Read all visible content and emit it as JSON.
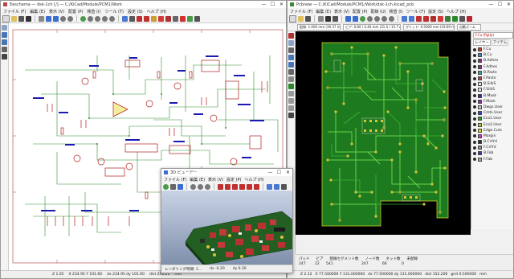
{
  "schematic": {
    "title": "Eeschema — dsk-1ch [/] — C:/KiCad/Module/PCM1/Work",
    "menu": [
      "ファイル (F)",
      "編集 (E)",
      "表示 (V)",
      "配置 (P)",
      "検査 (I)",
      "ツール (T)",
      "設定 (S)",
      "ヘルプ (H)"
    ],
    "status": {
      "zoom": "Z 1.05",
      "xy": "X 234.95  Y 101.60",
      "dxy": "dx 234.95  dy 101.60",
      "dist": "dist 256.21",
      "units": "mm"
    }
  },
  "pcbnew": {
    "title": "Pcbnew — C:/KiCad/Module/PCM1/Work/dsk-1ch.kicad_pcb",
    "menu": [
      "ファイル (F)",
      "編集 (E)",
      "表示 (V)",
      "配置 (P)",
      "配線 (U)",
      "検査 (I)",
      "ツール (T)",
      "設定 (S)",
      "ヘルプ (H)"
    ],
    "combos": [
      "配線: 1.000 mm (39.37 mils)",
      "ビア: 0.80 / 0.40 mm (31.5 / 15.7 mils)",
      "グリッド: 0.5000 mm (19.69 mils)",
      "自動ズーム"
    ],
    "stats_headers": [
      "パッド",
      "ビア",
      "配線セグメント数",
      "ノード数",
      "ネット数",
      "未配線"
    ],
    "stats_values": [
      "247",
      "22",
      "541",
      "247",
      "66",
      "0"
    ],
    "status": {
      "zoom": "Z 2.12",
      "xy": "X 77.500000  Y 131.000000",
      "dxy": "dx 77.500000  dy 131.000000",
      "dist": "dist 152.206",
      "grid": "grid 0.500000",
      "units": "mm"
    }
  },
  "layers": {
    "active": "F.Cu (PgUp)",
    "tabs": [
      "レイヤー",
      "アイテム"
    ],
    "items": [
      {
        "name": "F.Cu",
        "color": "#c83434"
      },
      {
        "name": "B.Cu",
        "color": "#4d7fc4"
      },
      {
        "name": "B.Adhes",
        "color": "#8c2b8c"
      },
      {
        "name": "F.Adhes",
        "color": "#8c2b8c"
      },
      {
        "name": "B.Paste",
        "color": "#3fa3a3"
      },
      {
        "name": "F.Paste",
        "color": "#b04848"
      },
      {
        "name": "B.SilkS",
        "color": "#e6e6e6"
      },
      {
        "name": "F.SilkS",
        "color": "#e2e2e2"
      },
      {
        "name": "B.Mask",
        "color": "#2e2e9c"
      },
      {
        "name": "F.Mask",
        "color": "#932a93"
      },
      {
        "name": "Dwgs.User",
        "color": "#c0c0c0"
      },
      {
        "name": "Cmts.User",
        "color": "#3c3cbf"
      },
      {
        "name": "Eco1.User",
        "color": "#2c9c2c"
      },
      {
        "name": "Eco2.User",
        "color": "#c2c23a"
      },
      {
        "name": "Edge.Cuts",
        "color": "#d8d820"
      },
      {
        "name": "Margin",
        "color": "#d43ad4"
      },
      {
        "name": "B.CrtYd",
        "color": "#2f2f2f"
      },
      {
        "name": "F.CrtYd",
        "color": "#8f8f8f"
      },
      {
        "name": "B.Fab",
        "color": "#3a3a98"
      },
      {
        "name": "F.Fab",
        "color": "#a8a8a8"
      }
    ]
  },
  "viewer3d": {
    "title": "3D ビューアー",
    "menu": [
      "ファイル (F)",
      "編集 (E)",
      "表示 (V)",
      "設定 (P)",
      "ヘルプ (H)"
    ],
    "status": {
      "label": "レンダリング時間: 1...",
      "dx": "dx -0.20",
      "dy": "dy 0.20"
    }
  },
  "colors": {
    "schematic_bg": "#ffffff",
    "pcb_bg": "#000000",
    "board_green": "#1e7a1e",
    "copper_bright": "#64d14a",
    "pad_yellow": "#d9c33a",
    "wire_green": "#2f8f2f",
    "component_red": "#b02020",
    "label_blue": "#1a1ab0"
  }
}
